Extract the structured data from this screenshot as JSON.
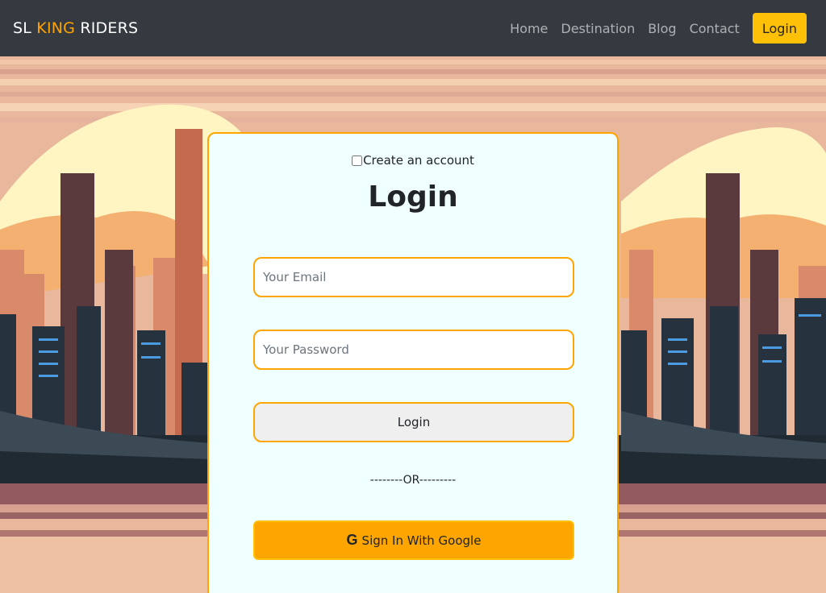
{
  "nav": {
    "brand_prefix": "SL ",
    "brand_highlight": "KING",
    "brand_suffix": " RIDERS",
    "links": [
      "Home",
      "Destination",
      "Blog",
      "Contact"
    ],
    "login_label": "Login"
  },
  "form": {
    "create_account_label": "Create an account",
    "create_account_checked": false,
    "title": "Login",
    "email_placeholder": "Your Email",
    "email_value": "",
    "password_placeholder": "Your Password",
    "password_value": "",
    "login_button": "Login",
    "or_separator": "--------OR---------",
    "google_button": "Sign In With Google",
    "google_icon": "G"
  },
  "colors": {
    "navbar": "#343a40",
    "accent_orange": "#ffa500",
    "accent_yellow": "#ffc107",
    "card_bg": "#f0ffff",
    "sky_light": "#fff6c4",
    "building_dark": "#1f2a33"
  },
  "icons": {
    "google": "google-icon"
  }
}
